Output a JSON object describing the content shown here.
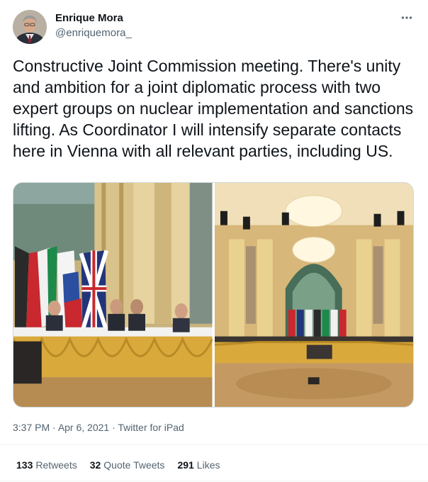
{
  "author": {
    "name": "Enrique Mora",
    "handle": "@enriquemora_"
  },
  "tweet": {
    "text": "Constructive Joint Commission meeting. There's unity and ambition for a joint diplomatic process with two expert groups on nuclear implementation and sanctions lifting. As Coordinator I will intensify separate contacts here in Vienna with all relevant parties, including US."
  },
  "media": {
    "photo_count": 2
  },
  "meta": {
    "time": "3:37 PM",
    "separator": " · ",
    "date": "Apr 6, 2021",
    "source": "Twitter for iPad"
  },
  "stats": {
    "retweets_count": "133",
    "retweets_label": "Retweets",
    "quotes_count": "32",
    "quotes_label": "Quote Tweets",
    "likes_count": "291",
    "likes_label": "Likes"
  },
  "icons": {
    "more": "more-horizontal-icon"
  },
  "colors": {
    "text": "#0f1419",
    "secondary": "#536471",
    "divider": "#eff3f4"
  }
}
